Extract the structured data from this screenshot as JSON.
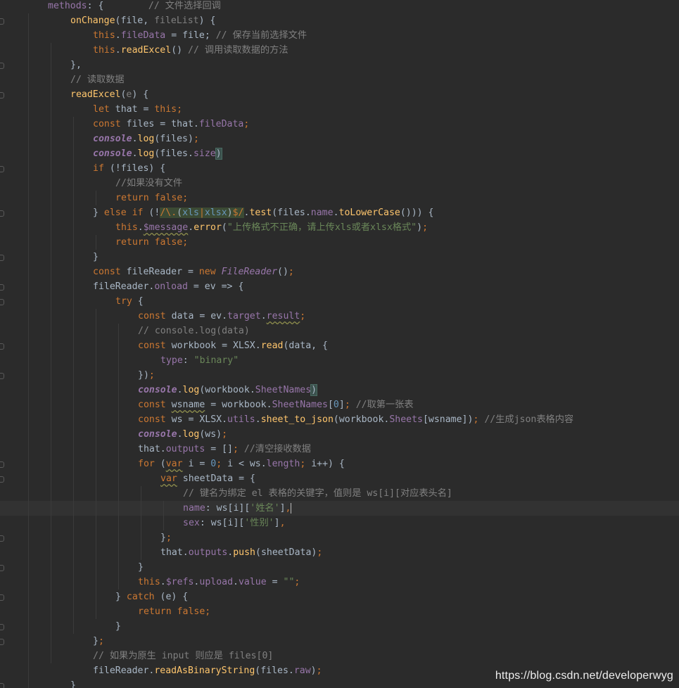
{
  "editor": {
    "colors": {
      "background": "#2b2b2b",
      "keyword": "#cc7832",
      "string": "#6a8759",
      "number": "#6897bb",
      "comment": "#808080",
      "function": "#ffc66d",
      "property": "#9876aa",
      "text": "#a9b7c6"
    },
    "lines": [
      [
        [
          "prop",
          "methods"
        ],
        [
          "plain",
          ": {        "
        ],
        [
          "cm",
          "// 文件选择回调"
        ]
      ],
      [
        [
          "fn",
          "onChange"
        ],
        [
          "plain",
          "(file, "
        ],
        [
          "param",
          "fileList"
        ],
        [
          "plain",
          ") {"
        ]
      ],
      [
        [
          "kw",
          "this"
        ],
        [
          "plain",
          "."
        ],
        [
          "prop",
          "fileData"
        ],
        [
          "plain",
          " = file; "
        ],
        [
          "cm",
          "// 保存当前选择文件"
        ]
      ],
      [
        [
          "kw",
          "this"
        ],
        [
          "plain",
          "."
        ],
        [
          "fn",
          "readExcel"
        ],
        [
          "plain",
          "() "
        ],
        [
          "cm",
          "// 调用读取数据的方法"
        ]
      ],
      [
        [
          "plain",
          "},"
        ]
      ],
      [
        [
          "cm",
          "// 读取数据"
        ]
      ],
      [
        [
          "fn",
          "readExcel"
        ],
        [
          "plain",
          "("
        ],
        [
          "param",
          "e"
        ],
        [
          "plain",
          ") {"
        ]
      ],
      [
        [
          "kw",
          "let "
        ],
        [
          "plain",
          "that = "
        ],
        [
          "kw",
          "this;"
        ]
      ],
      [
        [
          "kw",
          "const "
        ],
        [
          "plain",
          "files = that."
        ],
        [
          "prop",
          "fileData"
        ],
        [
          "kw",
          ";"
        ]
      ],
      [
        [
          "it",
          "console"
        ],
        [
          "plain",
          "."
        ],
        [
          "fn",
          "log"
        ],
        [
          "plain",
          "(files)"
        ],
        [
          "kw",
          ";"
        ]
      ],
      [
        [
          "it",
          "console"
        ],
        [
          "plain",
          "."
        ],
        [
          "fn",
          "log"
        ],
        [
          "plain",
          "(files."
        ],
        [
          "prop",
          "size"
        ],
        [
          "plain",
          ")"
        ]
      ],
      [
        [
          "kw",
          "if "
        ],
        [
          "plain",
          "(!files) {"
        ]
      ],
      [
        [
          "cm",
          "//如果没有文件"
        ]
      ],
      [
        [
          "kw",
          "return false;"
        ]
      ],
      [
        [
          "plain",
          "} "
        ],
        [
          "kw",
          "else if "
        ],
        [
          "plain",
          "(!"
        ],
        [
          "rx",
          "/\\.(xls|xlsx)$/"
        ],
        [
          "plain",
          "."
        ],
        [
          "fn",
          "test"
        ],
        [
          "plain",
          "(files."
        ],
        [
          "prop",
          "name"
        ],
        [
          "plain",
          "."
        ],
        [
          "fn",
          "toLowerCase"
        ],
        [
          "plain",
          "())) {"
        ]
      ],
      [
        [
          "kw",
          "this"
        ],
        [
          "plain",
          "."
        ],
        [
          "fnw",
          "$message"
        ],
        [
          "plain",
          "."
        ],
        [
          "fn",
          "error"
        ],
        [
          "plain",
          "("
        ],
        [
          "str",
          "\"上传格式不正确，请上传xls或者xlsx格式\""
        ],
        [
          "plain",
          ")"
        ],
        [
          "kw",
          ";"
        ]
      ],
      [
        [
          "kw",
          "return false;"
        ]
      ],
      [
        [
          "plain",
          "}"
        ]
      ],
      [
        [
          "kw",
          "const "
        ],
        [
          "plain",
          "fileReader = "
        ],
        [
          "kw",
          "new "
        ],
        [
          "cls",
          "FileReader"
        ],
        [
          "plain",
          "()"
        ],
        [
          "kw",
          ";"
        ]
      ],
      [
        [
          "plain",
          "fileReader."
        ],
        [
          "prop",
          "onload"
        ],
        [
          "plain",
          " = ev => {"
        ]
      ],
      [
        [
          "kw",
          "try "
        ],
        [
          "plain",
          "{"
        ]
      ],
      [
        [
          "kw",
          "const "
        ],
        [
          "plain",
          "data = ev."
        ],
        [
          "prop",
          "target"
        ],
        [
          "plain",
          "."
        ],
        [
          "warn",
          "result"
        ],
        [
          "kw",
          ";"
        ]
      ],
      [
        [
          "cm",
          "// console.log(data)"
        ]
      ],
      [
        [
          "kw",
          "const "
        ],
        [
          "plain",
          "workbook = XLSX."
        ],
        [
          "fn",
          "read"
        ],
        [
          "plain",
          "(data, {"
        ]
      ],
      [
        [
          "prop",
          "type"
        ],
        [
          "plain",
          ": "
        ],
        [
          "str",
          "\"binary\""
        ]
      ],
      [
        [
          "plain",
          "})"
        ],
        [
          "kw",
          ";"
        ]
      ],
      [
        [
          "it",
          "console"
        ],
        [
          "plain",
          "."
        ],
        [
          "fn",
          "log"
        ],
        [
          "plain",
          "(workbook."
        ],
        [
          "prop",
          "SheetNames"
        ],
        [
          "plain",
          ")"
        ]
      ],
      [
        [
          "kw",
          "const "
        ],
        [
          "warnp",
          "wsname"
        ],
        [
          "plain",
          " = workbook."
        ],
        [
          "prop",
          "SheetNames"
        ],
        [
          "plain",
          "["
        ],
        [
          "num",
          "0"
        ],
        [
          "plain",
          "]"
        ],
        [
          "kw",
          "; "
        ],
        [
          "cm",
          "//取第一张表"
        ]
      ],
      [
        [
          "kw",
          "const "
        ],
        [
          "plain",
          "ws = XLSX."
        ],
        [
          "prop",
          "utils"
        ],
        [
          "plain",
          "."
        ],
        [
          "fn",
          "sheet_to_json"
        ],
        [
          "plain",
          "(workbook."
        ],
        [
          "prop",
          "Sheets"
        ],
        [
          "plain",
          "[wsname])"
        ],
        [
          "kw",
          "; "
        ],
        [
          "cm",
          "//生成json表格内容"
        ]
      ],
      [
        [
          "it",
          "console"
        ],
        [
          "plain",
          "."
        ],
        [
          "fn",
          "log"
        ],
        [
          "plain",
          "(ws)"
        ],
        [
          "kw",
          ";"
        ]
      ],
      [
        [
          "plain",
          "that."
        ],
        [
          "prop",
          "outputs"
        ],
        [
          "plain",
          " = []"
        ],
        [
          "kw",
          "; "
        ],
        [
          "cm",
          "//清空接收数据"
        ]
      ],
      [
        [
          "kw",
          "for "
        ],
        [
          "plain",
          "("
        ],
        [
          "kww",
          "var"
        ],
        [
          "plain",
          " i = "
        ],
        [
          "num",
          "0"
        ],
        [
          "kw",
          "; "
        ],
        [
          "plain",
          "i < ws."
        ],
        [
          "prop",
          "length"
        ],
        [
          "kw",
          "; "
        ],
        [
          "plain",
          "i++) {"
        ]
      ],
      [
        [
          "kww",
          "var"
        ],
        [
          "plain",
          " sheetData = {"
        ]
      ],
      [
        [
          "cm",
          "// 键名为绑定 el 表格的关键字，值则是 ws[i][对应表头名]"
        ]
      ],
      [
        [
          "prop",
          "name"
        ],
        [
          "plain",
          ": ws[i]["
        ],
        [
          "str",
          "'姓名'"
        ],
        [
          "plain",
          "]"
        ],
        [
          "kw",
          ","
        ]
      ],
      [
        [
          "prop",
          "sex"
        ],
        [
          "plain",
          ": ws[i]["
        ],
        [
          "str",
          "'性别'"
        ],
        [
          "plain",
          "]"
        ],
        [
          "kw",
          ","
        ]
      ],
      [
        [
          "plain",
          "}"
        ],
        [
          "kw",
          ";"
        ]
      ],
      [
        [
          "plain",
          "that."
        ],
        [
          "prop",
          "outputs"
        ],
        [
          "plain",
          "."
        ],
        [
          "fn",
          "push"
        ],
        [
          "plain",
          "(sheetData)"
        ],
        [
          "kw",
          ";"
        ]
      ],
      [
        [
          "plain",
          "}"
        ]
      ],
      [
        [
          "kw",
          "this"
        ],
        [
          "plain",
          "."
        ],
        [
          "prop",
          "$refs"
        ],
        [
          "plain",
          "."
        ],
        [
          "prop",
          "upload"
        ],
        [
          "plain",
          "."
        ],
        [
          "prop",
          "value"
        ],
        [
          "plain",
          " = "
        ],
        [
          "str",
          "\"\""
        ],
        [
          "kw",
          ";"
        ]
      ],
      [
        [
          "plain",
          "} "
        ],
        [
          "kw",
          "catch "
        ],
        [
          "plain",
          "(e) {"
        ]
      ],
      [
        [
          "kw",
          "return false;"
        ]
      ],
      [
        [
          "plain",
          "}"
        ]
      ],
      [
        [
          "plain",
          "}"
        ],
        [
          "kw",
          ";"
        ]
      ],
      [
        [
          "cm",
          "// 如果为原生 input 则应是 files[0]"
        ]
      ],
      [
        [
          "plain",
          "fileReader."
        ],
        [
          "fn",
          "readAsBinaryString"
        ],
        [
          "plain",
          "(files."
        ],
        [
          "prop",
          "raw"
        ],
        [
          "plain",
          ")"
        ],
        [
          "kw",
          ";"
        ]
      ],
      [
        [
          "plain",
          "}"
        ]
      ]
    ]
  },
  "watermark": "https://blog.csdn.net/developerwyg"
}
